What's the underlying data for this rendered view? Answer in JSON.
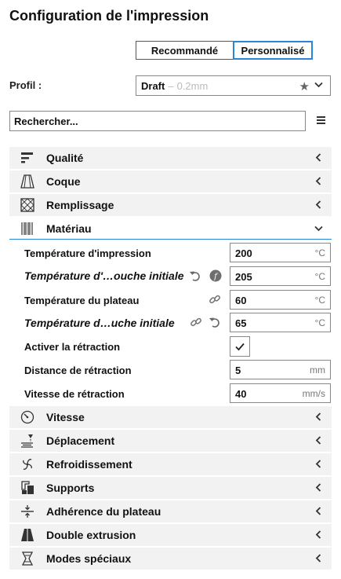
{
  "header": {
    "title": "Configuration de l'impression"
  },
  "mode": {
    "recommended": "Recommandé",
    "custom": "Personnalisé"
  },
  "profile": {
    "label": "Profil :",
    "name": "Draft",
    "separator": "–",
    "layer": "0.2mm"
  },
  "search": {
    "placeholder": "Rechercher..."
  },
  "categories": [
    {
      "label": "Qualité",
      "icon": "quality-icon"
    },
    {
      "label": "Coque",
      "icon": "shell-icon"
    },
    {
      "label": "Remplissage",
      "icon": "infill-icon"
    },
    {
      "label": "Matériau",
      "icon": "material-icon"
    },
    {
      "label": "Vitesse",
      "icon": "speed-icon"
    },
    {
      "label": "Déplacement",
      "icon": "travel-icon"
    },
    {
      "label": "Refroidissement",
      "icon": "cooling-icon"
    },
    {
      "label": "Supports",
      "icon": "support-icon"
    },
    {
      "label": "Adhérence du plateau",
      "icon": "adhesion-icon"
    },
    {
      "label": "Double extrusion",
      "icon": "dual-extrusion-icon"
    },
    {
      "label": "Modes spéciaux",
      "icon": "special-modes-icon"
    }
  ],
  "material": {
    "settings": [
      {
        "label": "Température d'impression",
        "value": "200",
        "unit": "°C"
      },
      {
        "label": "Température d'…ouche initiale",
        "value": "205",
        "unit": "°C"
      },
      {
        "label": "Température du plateau",
        "value": "60",
        "unit": "°C"
      },
      {
        "label": "Température d…uche initiale",
        "value": "65",
        "unit": "°C"
      },
      {
        "label": "Activer la rétraction",
        "checked": true
      },
      {
        "label": "Distance de rétraction",
        "value": "5",
        "unit": "mm"
      },
      {
        "label": "Vitesse de rétraction",
        "value": "40",
        "unit": "mm/s"
      }
    ]
  },
  "colors": {
    "accent": "#2a86d6",
    "category_bg": "#f2f2f2"
  }
}
